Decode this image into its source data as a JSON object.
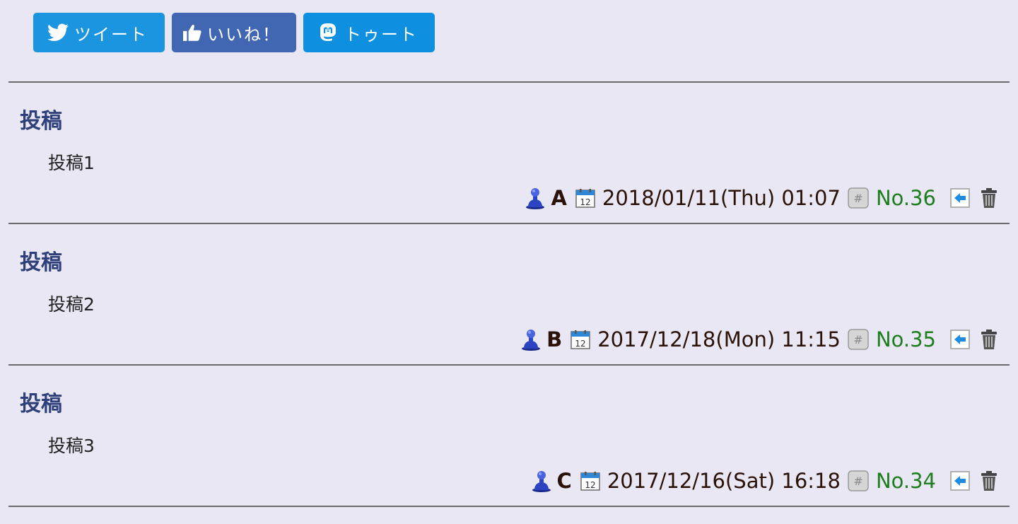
{
  "share": {
    "tweet_label": "ツイート",
    "like_label": "いいね！",
    "toot_label": "トゥート",
    "tweet_icon": "twitter-bird-icon",
    "like_icon": "thumbs-up-icon",
    "toot_icon": "mastodon-icon"
  },
  "posts": [
    {
      "title": "投稿",
      "body": "投稿1",
      "author": "A",
      "date": "2018/01/11(Thu) 01:07",
      "number": "No.36"
    },
    {
      "title": "投稿",
      "body": "投稿2",
      "author": "B",
      "date": "2017/12/18(Mon) 11:15",
      "number": "No.35"
    },
    {
      "title": "投稿",
      "body": "投稿3",
      "author": "C",
      "date": "2017/12/16(Sat) 16:18",
      "number": "No.34"
    }
  ],
  "colors": {
    "background": "#e8e7f3",
    "tweet": "#1b95e0",
    "like": "#4267b2",
    "toot": "#0f8fe0",
    "title": "#2e3f7a",
    "number": "#1e7d1e"
  }
}
